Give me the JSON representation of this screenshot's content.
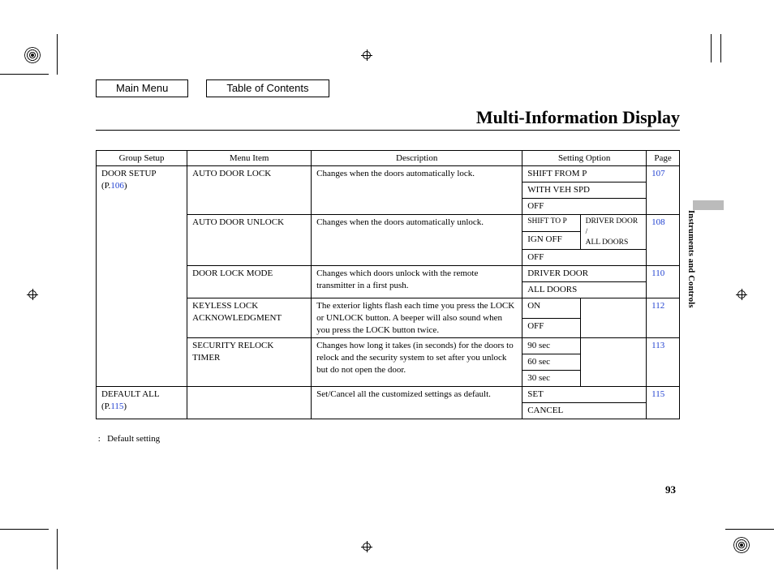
{
  "nav": {
    "main": "Main Menu",
    "toc": "Table of Contents"
  },
  "title": "Multi-Information Display",
  "side_tab": "Instruments and Controls",
  "footnote_prefix": ":",
  "footnote": "Default setting",
  "page_number": "93",
  "headers": {
    "group": "Group Setup",
    "item": "Menu Item",
    "desc": "Description",
    "opt": "Setting Option",
    "page": "Page"
  },
  "door_group": {
    "label": "DOOR SETUP",
    "p_prefix": "(P.",
    "p_link": "106",
    "p_suffix": ")"
  },
  "default_group": {
    "label": "DEFAULT ALL",
    "p_prefix": "(P.",
    "p_link": "115",
    "p_suffix": ")"
  },
  "auto_lock": {
    "item": "AUTO DOOR LOCK",
    "desc": "Changes when the doors automatically lock.",
    "opt1": "SHIFT FROM P",
    "opt2": "WITH VEH SPD",
    "opt3": "OFF",
    "page": "107"
  },
  "auto_unlock": {
    "item": "AUTO DOOR UNLOCK",
    "desc": "Changes when the doors automatically unlock.",
    "opt1a": "SHIFT TO P",
    "opt1b": "DRIVER DOOR /",
    "opt2a": "IGN OFF",
    "opt2b": "ALL DOORS",
    "opt3": "OFF",
    "page": "108"
  },
  "lock_mode": {
    "item": "DOOR LOCK MODE",
    "desc": "Changes which doors unlock with the remote transmitter in a first push.",
    "opt1": "DRIVER DOOR",
    "opt2": "ALL DOORS",
    "page": "110"
  },
  "keyless": {
    "item1": "KEYLESS LOCK",
    "item2": "ACKNOWLEDGMENT",
    "desc": "The exterior lights flash each time you press the LOCK or UNLOCK button. A beeper will also sound when you press the LOCK button twice.",
    "opt1": "ON",
    "opt2": "OFF",
    "page": "112"
  },
  "relock": {
    "item1": "SECURITY RELOCK",
    "item2": "TIMER",
    "desc": "Changes how long it takes (in seconds) for the doors to relock and the security system to set after you unlock but do not open the door.",
    "opt1": "90 sec",
    "opt2": "60 sec",
    "opt3": "30 sec",
    "page": "113"
  },
  "defaults": {
    "desc": "Set/Cancel all the customized settings as default.",
    "opt1": "SET",
    "opt2": "CANCEL",
    "page": "115"
  }
}
